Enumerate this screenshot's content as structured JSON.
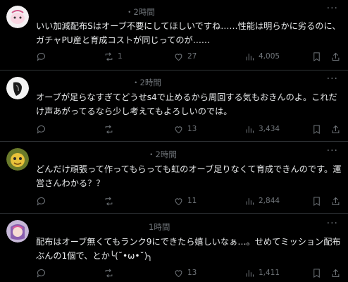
{
  "tweets": [
    {
      "time": "・2時間",
      "text": "いい加減配布Sはオーブ不要にしてほしいですね……性能は明らかに劣るのに、ガチャPU産と育成コストが同じってのが……",
      "reply_count": "",
      "retweet_count": "1",
      "like_count": "27",
      "view_count": "4,005"
    },
    {
      "time": "・2時間",
      "text": "オーブが足らなすぎてどうせs4で止めるから周回する気もおきんのよ。これだけ声あがってるなら少し考えてもよろしいのでは。",
      "reply_count": "",
      "retweet_count": "",
      "like_count": "13",
      "view_count": "3,434"
    },
    {
      "time": "・2時間",
      "text": "どんだけ頑張って作ってもらっても虹のオーブ足りなくて育成できんのです。運営さんわかる？？",
      "reply_count": "",
      "retweet_count": "",
      "like_count": "11",
      "view_count": "2,844"
    },
    {
      "time": "1時間",
      "text": "配布はオーブ無くてもランク9にできたら嬉しいなぁ…。せめてミッション配布ぶんの1個で、とか╰(˘•ω•˘)╮",
      "reply_count": "",
      "retweet_count": "",
      "like_count": "13",
      "view_count": "1,411"
    }
  ],
  "icons": {
    "more": "more-horizontal-icon",
    "reply": "reply-icon",
    "retweet": "retweet-icon",
    "like": "heart-icon",
    "views": "views-chart-icon",
    "bookmark": "bookmark-icon",
    "share": "share-icon"
  }
}
